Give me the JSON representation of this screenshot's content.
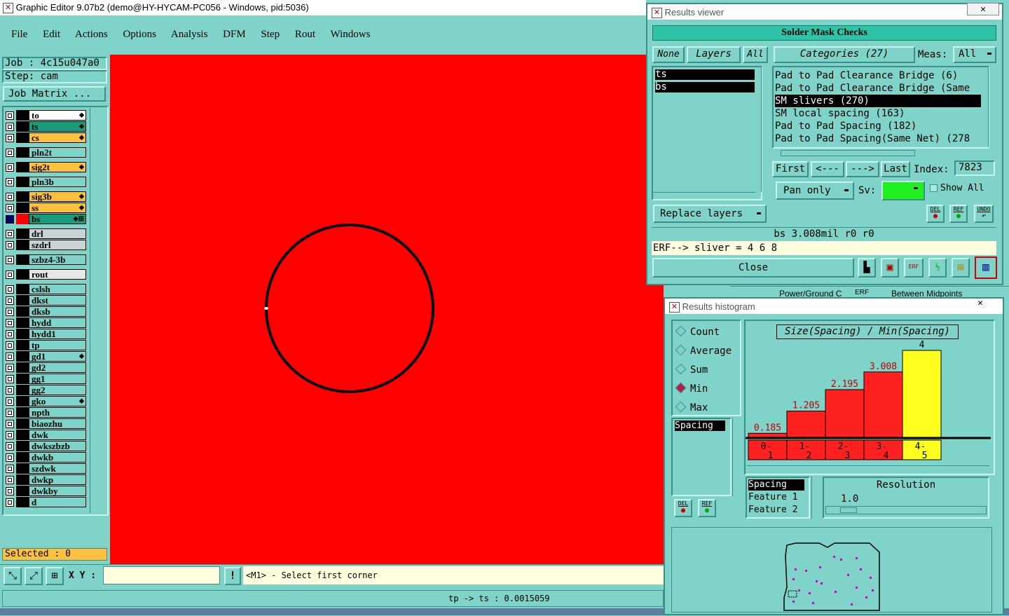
{
  "main_window": {
    "title": "Graphic Editor 9.07b2 (demo@HY-HYCAM-PC056 - Windows, pid:5036)",
    "menu": [
      "File",
      "Edit",
      "Actions",
      "Options",
      "Analysis",
      "DFM",
      "Step",
      "Rout",
      "Windows"
    ],
    "job": "Job : 4c15u047a0",
    "step": "Step: cam",
    "job_matrix": "Job Matrix ...",
    "layers": [
      {
        "name": "to",
        "color": "#ffffff",
        "mark": "⬥"
      },
      {
        "name": "ts",
        "color": "#1a9c7c",
        "mark": "⬥"
      },
      {
        "name": "cs",
        "color": "#ffc040",
        "mark": "⬥"
      },
      {
        "name": "pln2t",
        "color": "#7fd3c9",
        "mark": ""
      },
      {
        "name": "sig2t",
        "color": "#ffc040",
        "mark": "⬥"
      },
      {
        "name": "pln3b",
        "color": "#7fd3c9",
        "mark": ""
      },
      {
        "name": "sig3b",
        "color": "#ffc040",
        "mark": "⬥"
      },
      {
        "name": "ss",
        "color": "#ffc040",
        "mark": "⬥"
      },
      {
        "name": "bs",
        "color": "#1a9c7c",
        "mark": "⬥⊞"
      },
      {
        "name": "drl",
        "color": "#c8d4d4",
        "mark": ""
      },
      {
        "name": "szdrl",
        "color": "#c8d4d4",
        "mark": ""
      },
      {
        "name": "szbz4-3b",
        "color": "#7fd3c9",
        "mark": ""
      },
      {
        "name": "rout",
        "color": "#e8e8e8",
        "mark": ""
      },
      {
        "name": "cslsh",
        "color": "#7fd3c9",
        "mark": ""
      },
      {
        "name": "dkst",
        "color": "#7fd3c9",
        "mark": ""
      },
      {
        "name": "dksb",
        "color": "#7fd3c9",
        "mark": ""
      },
      {
        "name": "hydd",
        "color": "#7fd3c9",
        "mark": ""
      },
      {
        "name": "hydd1",
        "color": "#7fd3c9",
        "mark": ""
      },
      {
        "name": "tp",
        "color": "#7fd3c9",
        "mark": ""
      },
      {
        "name": "gd1",
        "color": "#7fd3c9",
        "mark": "⬥"
      },
      {
        "name": "gd2",
        "color": "#7fd3c9",
        "mark": ""
      },
      {
        "name": "gg1",
        "color": "#7fd3c9",
        "mark": ""
      },
      {
        "name": "gg2",
        "color": "#7fd3c9",
        "mark": ""
      },
      {
        "name": "gko",
        "color": "#7fd3c9",
        "mark": "⬥"
      },
      {
        "name": "npth",
        "color": "#7fd3c9",
        "mark": ""
      },
      {
        "name": "biaozhu",
        "color": "#7fd3c9",
        "mark": ""
      },
      {
        "name": "dwk",
        "color": "#7fd3c9",
        "mark": ""
      },
      {
        "name": "dwkszbzb",
        "color": "#7fd3c9",
        "mark": ""
      },
      {
        "name": "dwkb",
        "color": "#7fd3c9",
        "mark": ""
      },
      {
        "name": "szdwk",
        "color": "#7fd3c9",
        "mark": ""
      },
      {
        "name": "dwkp",
        "color": "#7fd3c9",
        "mark": ""
      },
      {
        "name": "dwkby",
        "color": "#7fd3c9",
        "mark": ""
      },
      {
        "name": "d",
        "color": "#7fd3c9",
        "mark": ""
      }
    ],
    "selected": "Selected : 0",
    "xy_label": "X Y :",
    "xy_value": "",
    "prompt": "<M1> - Select first corner",
    "status": "tp -> ts : 0.0015059",
    "canvas_color": "#ff0000"
  },
  "results_viewer": {
    "title": "Results viewer",
    "header": "Solder Mask Checks",
    "btn_none": "None",
    "btn_layers": "Layers",
    "btn_all": "All",
    "categories": "Categories (27)",
    "meas_label": "Meas:",
    "meas_value": "All",
    "layer_items": [
      "ts",
      "bs"
    ],
    "category_items": [
      "Pad to Pad Clearance Bridge (6)",
      "Pad to Pad Clearance Bridge (Same",
      "SM slivers (270)",
      "SM local spacing (163)",
      "Pad to Pad Spacing (182)",
      "Pad to Pad Spacing(Same Net) (278"
    ],
    "selected_category_index": 2,
    "nav": {
      "first": "First",
      "prev": "<---",
      "next": "--->",
      "last": "Last",
      "index_label": "Index:",
      "index_value": "7823"
    },
    "pan_only": "Pan only",
    "sv_label": "Sv:",
    "show_all": "Show All",
    "replace_layers": "Replace layers",
    "del": "DEL",
    "ref": "REF",
    "undo": "UNDO",
    "info": "bs 3.008mil  r0  r0",
    "erf": "ERF--> sliver = 4 6 8",
    "close": "Close"
  },
  "background_tabs": [
    "Power/Ground C",
    "ERF",
    "Between Midpoints"
  ],
  "results_histogram": {
    "title": "Results histogram",
    "modes": [
      "Count",
      "Average",
      "Sum",
      "Min",
      "Max"
    ],
    "active_mode": "Min",
    "list_items": [
      "Spacing"
    ],
    "field_items": [
      "Spacing",
      "Feature 1",
      "Feature 2"
    ],
    "resolution_label": "Resolution",
    "resolution_value": "1.0",
    "del": "DEL",
    "ref": "REF"
  },
  "chart_data": {
    "type": "bar",
    "title": "Size(Spacing) / Min(Spacing)",
    "categories": [
      "0-1",
      "1-2",
      "2-3",
      "3-4",
      "4-5"
    ],
    "values": [
      0.185,
      1.205,
      2.195,
      3.008,
      4
    ],
    "value_labels": [
      "0.185",
      "1.205",
      "2.195",
      "3.008",
      "4"
    ],
    "bar_colors": [
      "#ff2020",
      "#ff2020",
      "#ff2020",
      "#ff2020",
      "#ffff20"
    ],
    "highlight_index": 4,
    "ylim": [
      0,
      4
    ],
    "grid": false,
    "legend": "none"
  }
}
